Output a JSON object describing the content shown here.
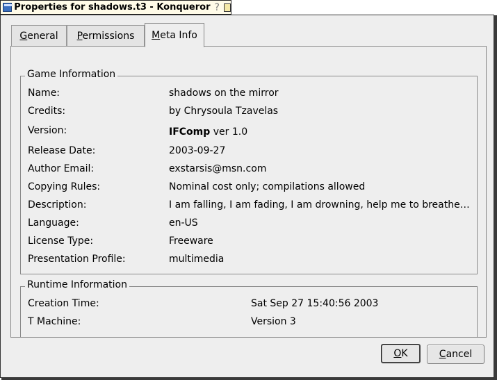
{
  "window": {
    "title": "Properties for shadows.t3 - Konqueror",
    "help_glyph": "?"
  },
  "tabs": [
    {
      "label": "General"
    },
    {
      "label": "Permissions"
    },
    {
      "label": "Meta Info",
      "active": true
    }
  ],
  "game_info": {
    "title": "Game Information",
    "rows": [
      {
        "label": "Name:",
        "value": "shadows on the mirror"
      },
      {
        "label": "Credits:",
        "value": "by Chrysoula Tzavelas"
      },
      {
        "label": "Version:",
        "value_bold": "IFComp",
        "value": " ver 1.0"
      },
      {
        "label": "Release Date:",
        "value": "2003-09-27"
      },
      {
        "label": "Author Email:",
        "value": "exstarsis@msn.com"
      },
      {
        "label": "Copying Rules:",
        "value": "Nominal cost only; compilations allowed"
      },
      {
        "label": "Description:",
        "value": "I am falling, I am fading, I am drowning, help me to breathe…"
      },
      {
        "label": "Language:",
        "value": "en-US"
      },
      {
        "label": "License Type:",
        "value": "Freeware"
      },
      {
        "label": "Presentation Profile:",
        "value": "multimedia"
      }
    ]
  },
  "runtime_info": {
    "title": "Runtime Information",
    "rows": [
      {
        "label": "Creation Time:",
        "value": "Sat Sep 27 15:40:56 2003"
      },
      {
        "label": "T Machine:",
        "value": "Version 3"
      }
    ]
  },
  "buttons": {
    "ok": "OK",
    "cancel": "Cancel"
  },
  "colors": {
    "title_bar": "#fffbe8",
    "dialog_bg": "#eeeeee"
  }
}
